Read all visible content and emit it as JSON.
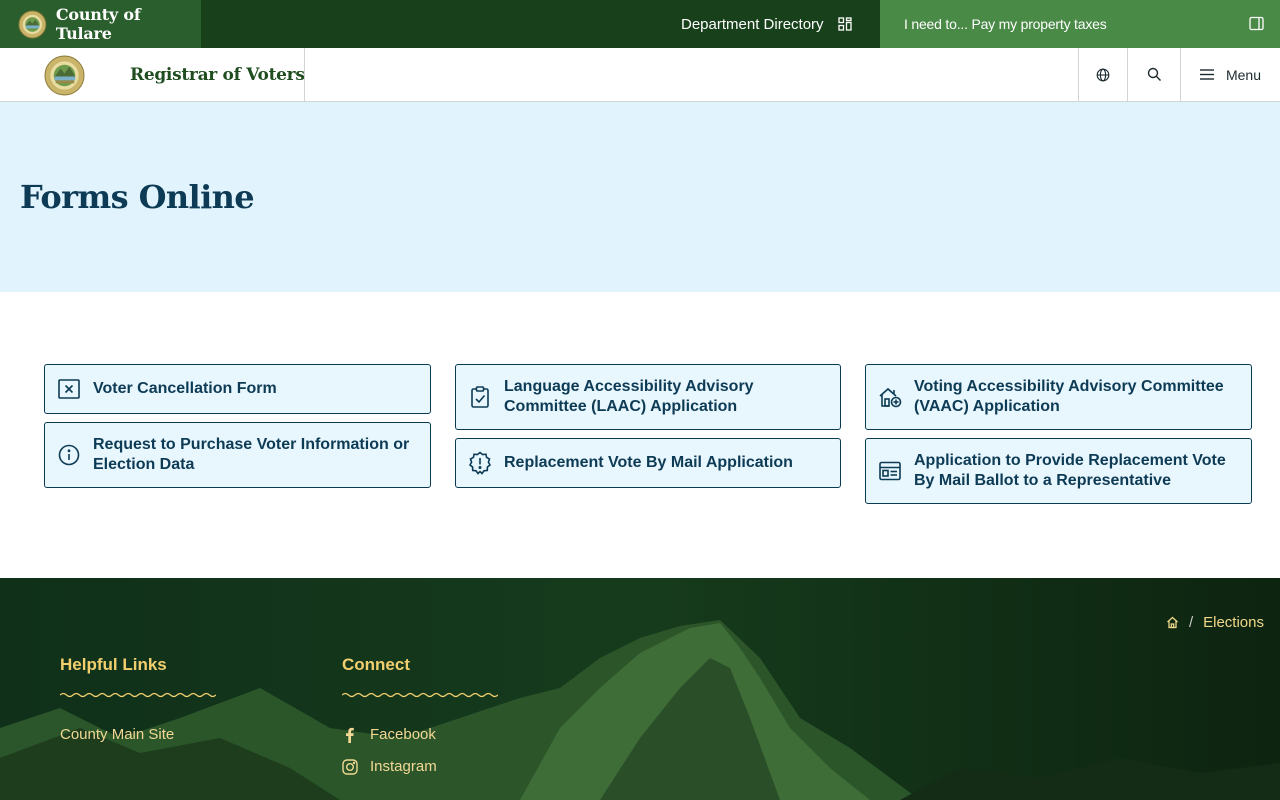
{
  "topbar": {
    "site_name": "County of Tulare",
    "department_directory": "Department Directory",
    "i_need_to": "I need to... Pay my property taxes"
  },
  "header": {
    "department_title": "Registrar of Voters",
    "menu_label": "Menu"
  },
  "hero": {
    "title": "Forms Online"
  },
  "forms": [
    {
      "label": "Voter Cancellation Form",
      "icon": "x-square-icon"
    },
    {
      "label": "Request to Purchase Voter Information or Election Data",
      "icon": "info-circle-icon"
    },
    {
      "label": "Language Accessibility Advisory Committee (LAAC) Application",
      "icon": "clipboard-check-icon"
    },
    {
      "label": "Replacement Vote By Mail Application",
      "icon": "alert-badge-icon"
    },
    {
      "label": "Voting Accessibility Advisory Committee (VAAC) Application",
      "icon": "home-accessible-icon"
    },
    {
      "label": "Application to Provide Replacement Vote By Mail Ballot to a Representative",
      "icon": "ballot-card-icon"
    }
  ],
  "footer": {
    "breadcrumb_current": "Elections",
    "helpful_links_heading": "Helpful Links",
    "helpful_links": [
      "County Main Site"
    ],
    "connect_heading": "Connect",
    "connect_links": [
      {
        "label": "Facebook",
        "icon": "facebook-icon"
      },
      {
        "label": "Instagram",
        "icon": "instagram-icon"
      }
    ]
  },
  "colors": {
    "topbar_dark": "#17401b",
    "brand_green": "#2a5e2d",
    "ineed_green": "#4a8a47",
    "hero_bg": "#e1f3fc",
    "card_bg": "#e8f6fd",
    "navy_text": "#0d3b55",
    "footer_gold": "#f2cf6e"
  }
}
